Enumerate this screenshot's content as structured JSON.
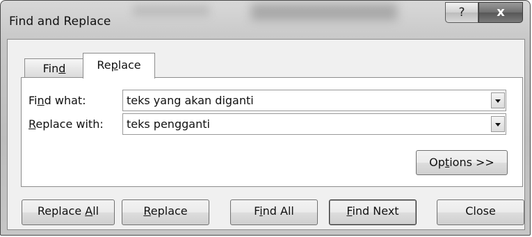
{
  "window": {
    "title": "Find and Replace",
    "help_glyph": "?",
    "close_glyph": "x"
  },
  "tabs": [
    {
      "prefix": "Fin",
      "mnemonic": "d",
      "suffix": "",
      "selected": false
    },
    {
      "prefix": "Re",
      "mnemonic": "p",
      "suffix": "lace",
      "selected": true
    }
  ],
  "find_what": {
    "label_prefix": "Fi",
    "label_mnemonic": "n",
    "label_suffix": "d what:",
    "value": "teks yang akan diganti"
  },
  "replace_with": {
    "label_prefix": "",
    "label_mnemonic": "R",
    "label_suffix": "eplace with:",
    "value": "teks pengganti"
  },
  "buttons": {
    "options": {
      "prefix": "Op",
      "mnemonic": "t",
      "suffix": "ions >>"
    },
    "replace_all": {
      "prefix": "Replace ",
      "mnemonic": "A",
      "suffix": "ll"
    },
    "replace": {
      "prefix": "",
      "mnemonic": "R",
      "suffix": "eplace"
    },
    "find_all": {
      "prefix": "F",
      "mnemonic": "i",
      "suffix": "nd All"
    },
    "find_next": {
      "prefix": "",
      "mnemonic": "F",
      "suffix": "ind Next"
    },
    "close": {
      "label": "Close"
    }
  },
  "icons": {
    "help": "help-icon",
    "close": "close-icon",
    "dropdown": "chevron-down-icon"
  }
}
